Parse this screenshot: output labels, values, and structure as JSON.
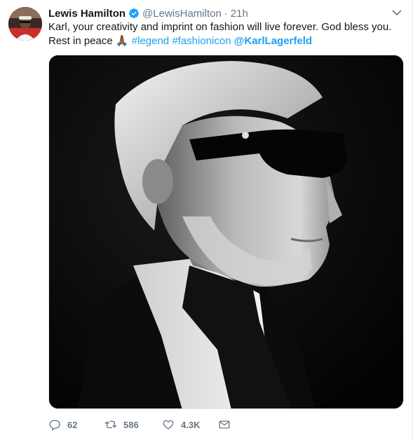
{
  "tweet": {
    "author_name": "Lewis Hamilton",
    "author_handle": "@LewisHamilton",
    "separator": "·",
    "timestamp": "21h",
    "text_main": "Karl, your creativity and imprint on fashion will live forever. God bless you. Rest in peace",
    "emoji": "🙏🏾",
    "hashtags": [
      "#legend",
      "#fashionicon"
    ],
    "mention": "@KarlLagerfeld",
    "media_type": "black-and-white portrait photo",
    "reply_count": "62",
    "retweet_count": "586",
    "like_count": "4.3K"
  },
  "icons": {
    "verified": "verified-badge-icon",
    "caret": "chevron-down-icon",
    "reply": "reply-icon",
    "retweet": "retweet-icon",
    "like": "heart-icon",
    "dm": "envelope-icon"
  },
  "colors": {
    "link": "#1da1f2",
    "secondary_text": "#657786",
    "primary_text": "#14171a"
  }
}
